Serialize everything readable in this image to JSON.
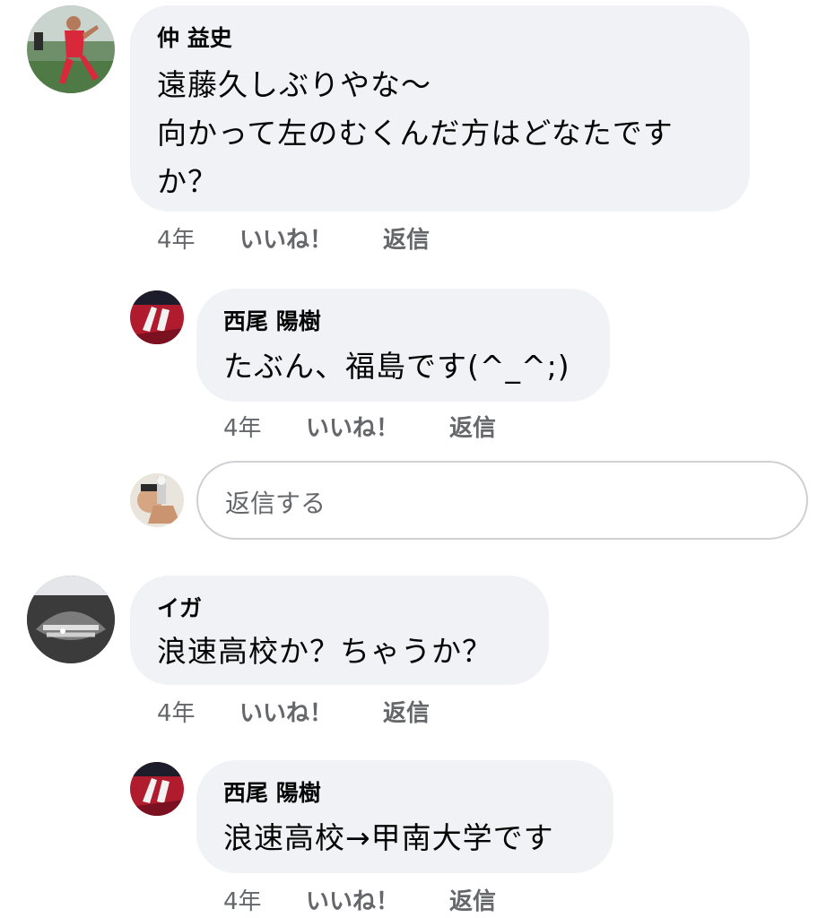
{
  "comments": [
    {
      "author": "仲 益史",
      "lines": [
        "遠藤久しぶりやな〜",
        "向かって左のむくんだ方はどなたです",
        "か？"
      ],
      "time": "4年",
      "like": "いいね！",
      "reply": "返信"
    },
    {
      "author": "西尾 陽樹",
      "lines": [
        "たぶん、福島です(^_^;)"
      ],
      "time": "4年",
      "like": "いいね！",
      "reply": "返信"
    },
    {
      "author": "イガ",
      "lines": [
        "浪速高校か？ちゃうか？"
      ],
      "time": "4年",
      "like": "いいね！",
      "reply": "返信"
    },
    {
      "author": "西尾 陽樹",
      "lines": [
        "浪速高校→甲南大学です"
      ],
      "time": "4年",
      "like": "いいね！",
      "reply": "返信"
    }
  ],
  "reply_input": {
    "placeholder": "返信する"
  },
  "colors": {
    "bubble": "#f0f2f5",
    "meta_text": "#65676b",
    "input_border": "#ced0d4"
  }
}
